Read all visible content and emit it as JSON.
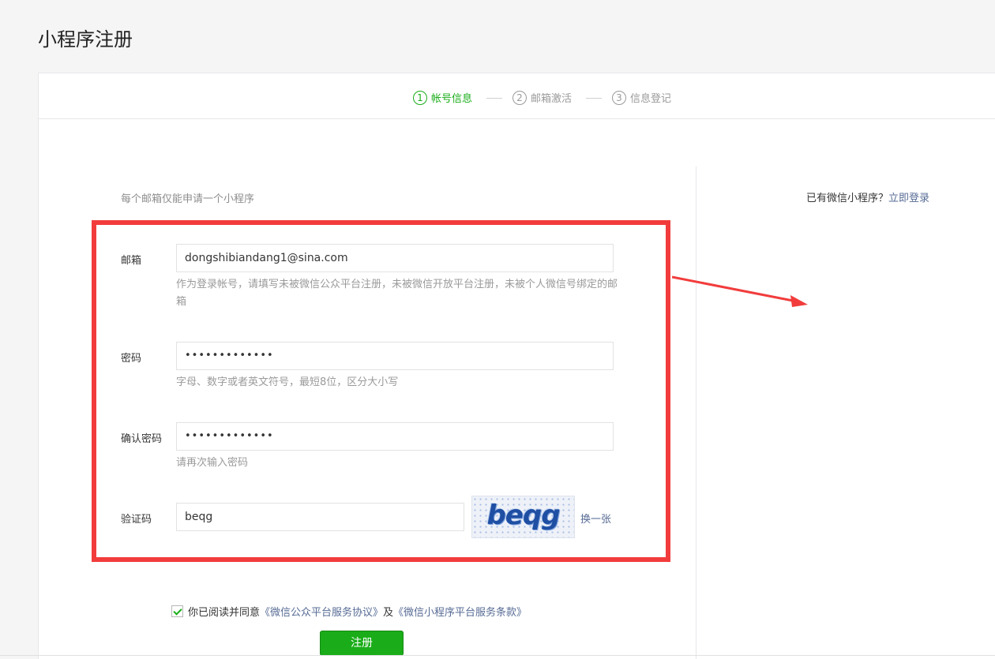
{
  "page": {
    "title": "小程序注册"
  },
  "steps": [
    {
      "num": "1",
      "label": "帐号信息"
    },
    {
      "num": "2",
      "label": "邮箱激活"
    },
    {
      "num": "3",
      "label": "信息登记"
    }
  ],
  "form": {
    "tip": "每个邮箱仅能申请一个小程序",
    "email": {
      "label": "邮箱",
      "value": "dongshibiandang1@sina.com",
      "hint": "作为登录帐号，请填写未被微信公众平台注册，未被微信开放平台注册，未被个人微信号绑定的邮箱"
    },
    "password": {
      "label": "密码",
      "value": "•••••••••••••",
      "hint": "字母、数字或者英文符号，最短8位，区分大小写"
    },
    "confirm_password": {
      "label": "确认密码",
      "value": "•••••••••••••",
      "hint": "请再次输入密码"
    },
    "captcha": {
      "label": "验证码",
      "value": "beqg",
      "image_text": "beqg",
      "change_label": "换一张"
    },
    "agreement": {
      "prefix": "你已阅读并同意",
      "link1": "《微信公众平台服务协议》",
      "middle": "及",
      "link2": "《微信小程序平台服务条款》",
      "checked": true
    },
    "submit_label": "注册"
  },
  "side": {
    "question": "已有微信小程序？",
    "login_link": "立即登录"
  },
  "colors": {
    "accent": "#1aad19",
    "link": "#576b95",
    "annotation_red": "#f23c3c"
  }
}
